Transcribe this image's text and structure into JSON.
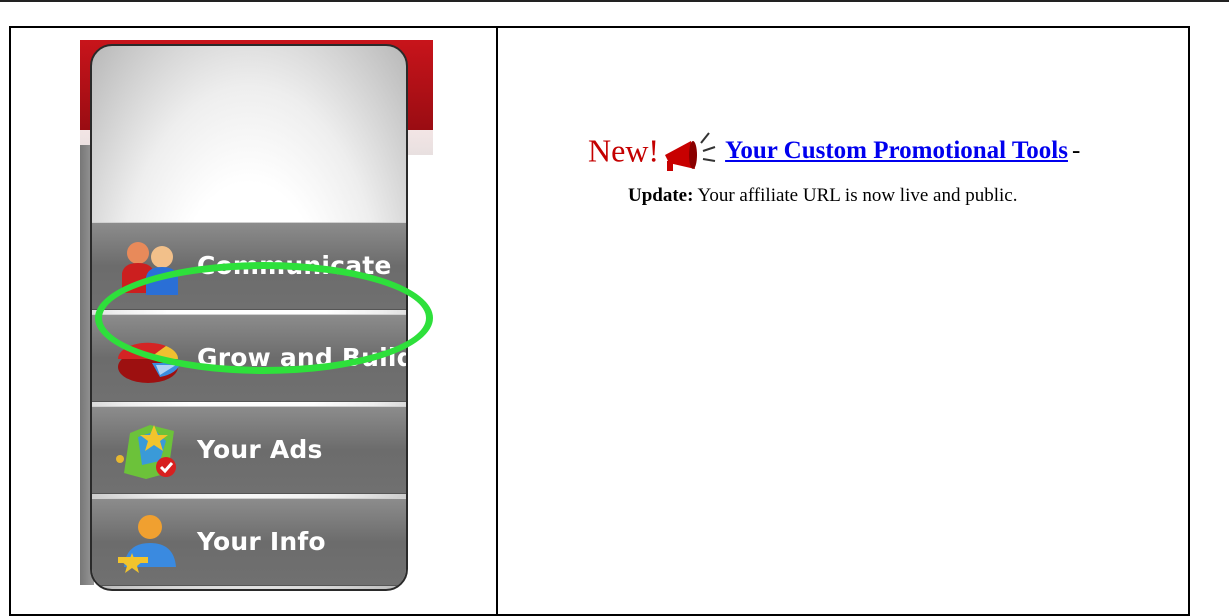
{
  "menu": {
    "items": [
      {
        "label": "Communicate",
        "icon": "people-icon"
      },
      {
        "label": "Grow and Build",
        "icon": "pie-chart-icon"
      },
      {
        "label": "Your Ads",
        "icon": "map-pin-icon"
      },
      {
        "label": "Your Info",
        "icon": "user-icon"
      }
    ],
    "highlighted_item": "Grow and Build"
  },
  "announcement": {
    "badge": "New!",
    "link_text": "Your Custom Promotional Tools",
    "suffix": "-",
    "update_label": "Update:",
    "update_text": " Your affiliate URL is now live and public."
  },
  "colors": {
    "badge_red": "#c40000",
    "link_blue": "#0000ee",
    "highlight_green": "#2ee03b",
    "header_red": "#b5121b"
  }
}
